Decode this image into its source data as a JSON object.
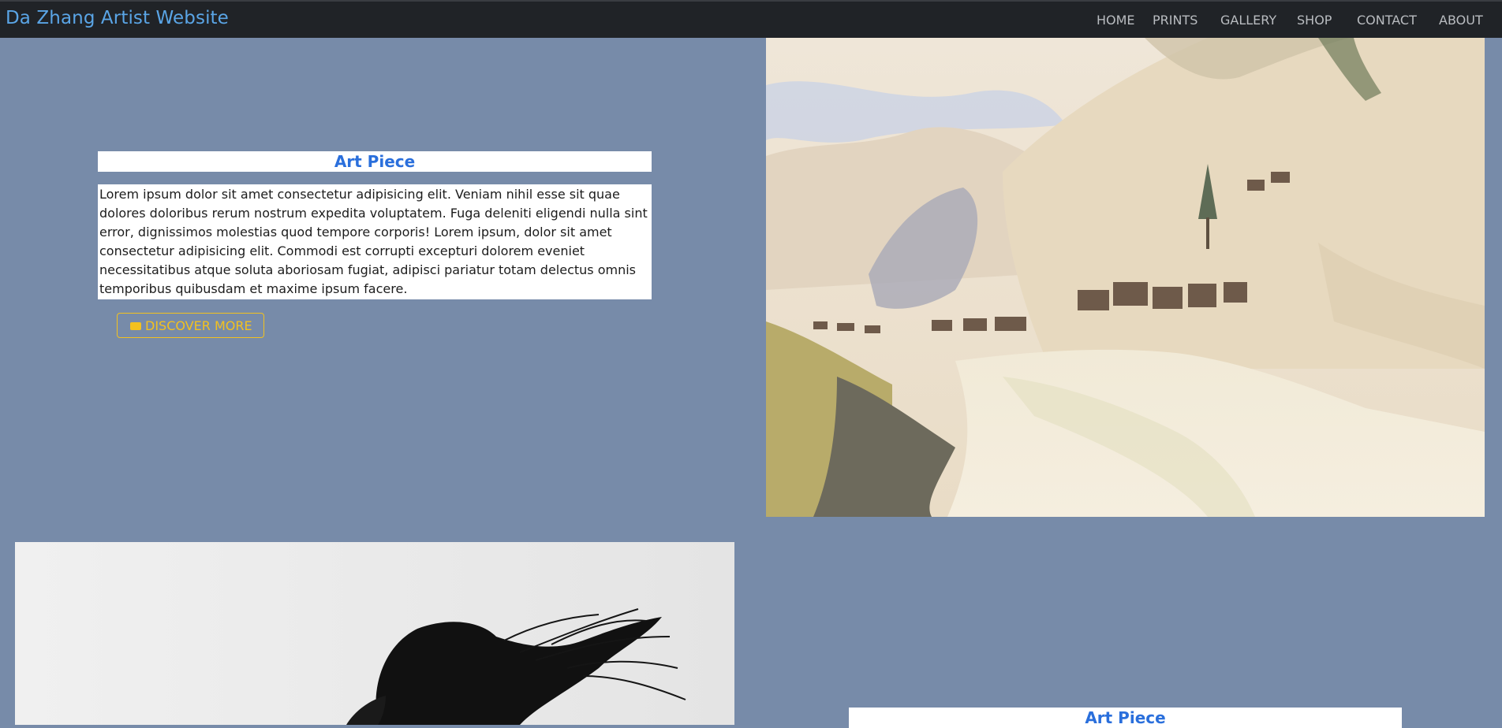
{
  "navbar": {
    "brand": "Da Zhang Artist Website",
    "links": [
      "HOME",
      "PRINTS",
      "GALLERY",
      "SHOP",
      "CONTACT",
      "ABOUT"
    ]
  },
  "section1": {
    "title": "Art Piece",
    "description": "Lorem ipsum dolor sit amet consectetur adipisicing elit. Veniam nihil esse sit quae dolores doloribus rerum nostrum expedita voluptatem. Fuga deleniti eligendi nulla sint error, dignissimos molestias quod tempore corporis! Lorem ipsum, dolor sit amet consectetur adipisicing elit. Commodi est corrupti excepturi dolorem eveniet necessitatibus atque soluta aboriosam fugiat, adipisci pariatur totam delectus omnis temporibus quibusdam et maxime ipsum facere.",
    "button_label": "DISCOVER MORE",
    "button_icon": "ticket-icon",
    "image": "mountain-village-watercolor"
  },
  "section2": {
    "title": "Art Piece",
    "image": "black-white-hair-photo"
  },
  "colors": {
    "page_background": "#778ba9",
    "navbar_background": "#202327",
    "brand": "#5aa5e6",
    "nav_link": "#b9bcc0",
    "title": "#2a6fdc",
    "button_accent": "#f3c11e"
  }
}
